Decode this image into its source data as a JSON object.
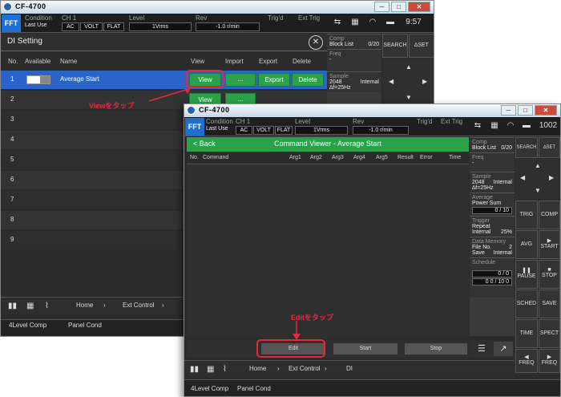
{
  "app": {
    "title": "CF-4700",
    "mode": "FFT",
    "clock1": "9:57",
    "clock2": "1002"
  },
  "header": {
    "condition_label": "Condition",
    "condition_value": "Last Use",
    "ch_label": "CH 1",
    "ac": "AC",
    "volt": "VOLT",
    "flat": "FLAT",
    "level_label": "Level",
    "level_value": "1Vrms",
    "rev_label": "Rev",
    "rev_value": "-1.0 r/min",
    "trigd": "Trig'd",
    "ext_trig": "Ext Trig"
  },
  "di": {
    "title": "DI Setting",
    "cols": {
      "no": "No.",
      "available": "Available",
      "name": "Name",
      "view": "View",
      "import": "Import",
      "export": "Export",
      "delete": "Delete"
    },
    "rows": [
      {
        "no": "1",
        "name": "Average Start"
      },
      {
        "no": "2"
      },
      {
        "no": "3"
      },
      {
        "no": "4"
      },
      {
        "no": "5"
      },
      {
        "no": "6"
      },
      {
        "no": "7"
      },
      {
        "no": "8"
      },
      {
        "no": "9"
      }
    ],
    "view": "View",
    "dots": "...",
    "export_btn": "Export",
    "delete_btn": "Delete"
  },
  "side": {
    "comp": "Comp",
    "block_list": "Block List",
    "block_val": "0/20",
    "freq": "Freq",
    "freq_val": "-",
    "sample": "Sample",
    "sample_val": "2048",
    "internal": "Internal",
    "df": "∆f=25Hz",
    "search": "SEARCH",
    "set": "∆SET",
    "average": "Average",
    "power_sum": "Power Sum",
    "avg_count": "0 / 10",
    "trigger": "Trigger",
    "repeat": "Repeat",
    "trig_internal": "Internal",
    "trig_pct": "25%",
    "data_memory": "Data Memory",
    "file_no": "File No.",
    "file_no_val": "2",
    "save": "Save",
    "save_val": "Internal",
    "schedule": "Schedule",
    "sched1": "0 / 0",
    "sched2": "0 0 / 10 0"
  },
  "right_btns": {
    "trig": "TRIG",
    "comp": "COMP",
    "avg": "AVG",
    "start": "START",
    "pause": "PAUSE",
    "stop": "STOP",
    "sched": "SCHED",
    "save": "SAVE",
    "time": "TIME",
    "spect": "SPECT",
    "freq": "FREQ"
  },
  "nav1": {
    "home": "Home",
    "ext": "Ext Control",
    "level4": "4Level Comp",
    "panel": "Panel Cond"
  },
  "nav2": {
    "home": "Home",
    "ext": "Ext Control",
    "di": "DI",
    "level4": "4Level Comp",
    "panel": "Panel Cond"
  },
  "cmd": {
    "back": "< Back",
    "title": "Command Viewer - Average Start",
    "cols": [
      "No.",
      "Command",
      "Arg1",
      "Arg2",
      "Arg3",
      "Arg4",
      "Arg5",
      "Result",
      "Error",
      "Time"
    ],
    "edit": "Edit",
    "start": "Start",
    "stop": "Stop"
  },
  "annotations": {
    "view": "Viewをタップ",
    "edit": "Editをタップ"
  },
  "colors": {
    "accent_blue": "#1f6fd1",
    "green": "#2aa14a",
    "red": "#e6283c"
  }
}
